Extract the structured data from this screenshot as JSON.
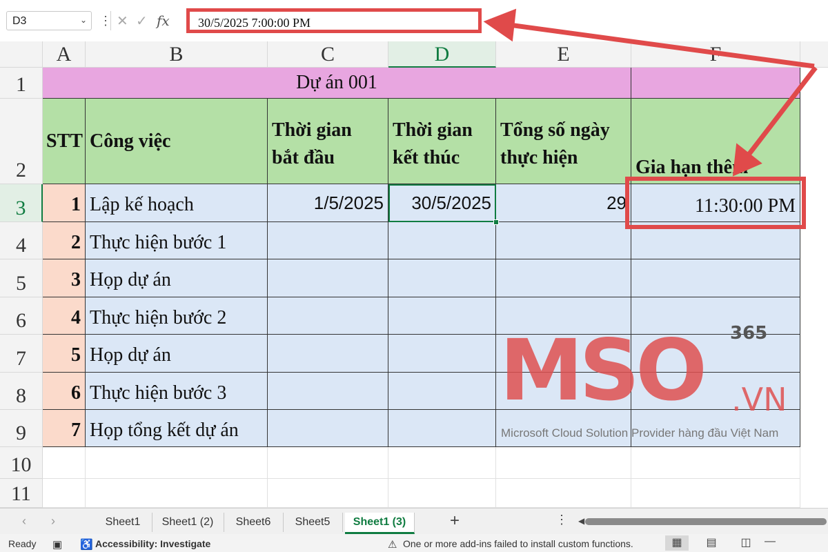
{
  "formula_bar": {
    "name_box": "D3",
    "cancel_icon": "✕",
    "enter_icon": "✓",
    "fx_label": "fx",
    "formula_value": "30/5/2025  7:00:00 PM"
  },
  "columns": [
    "A",
    "B",
    "C",
    "D",
    "E",
    "F"
  ],
  "rows": [
    "1",
    "2",
    "3",
    "4",
    "5",
    "6",
    "7",
    "8",
    "9",
    "10",
    "11"
  ],
  "sheet": {
    "title": "Dự án 001",
    "headers": {
      "stt": "STT",
      "cong_viec": "Công việc",
      "thoi_gian_bat_dau_1": "Thời gian",
      "thoi_gian_bat_dau_2": "bắt đầu",
      "thoi_gian_ket_thuc_1": "Thời gian",
      "thoi_gian_ket_thuc_2": "kết thúc",
      "tong_so_ngay_1": "Tổng số ngày",
      "tong_so_ngay_2": "thực hiện",
      "gia_han_them": "Gia hạn thêm"
    },
    "tasks": [
      {
        "stt": "1",
        "name": "Lập kế hoạch",
        "start": "1/5/2025",
        "end": "30/5/2025",
        "days": "29",
        "extend": "11:30:00 PM"
      },
      {
        "stt": "2",
        "name": "Thực hiện bước 1"
      },
      {
        "stt": "3",
        "name": "Họp dự án"
      },
      {
        "stt": "4",
        "name": "Thực hiện bước 2"
      },
      {
        "stt": "5",
        "name": "Họp dự án"
      },
      {
        "stt": "6",
        "name": "Thực hiện bước 3"
      },
      {
        "stt": "7",
        "name": "Họp tổng kết dự án"
      }
    ]
  },
  "watermark": {
    "logo": "MSO",
    "sup": "365",
    "domain": ".VN",
    "tagline": "Microsoft Cloud Solution Provider hàng đầu Việt Nam"
  },
  "sheet_tabs": [
    "Sheet1",
    "Sheet1 (2)",
    "Sheet6",
    "Sheet5",
    "Sheet1 (3)"
  ],
  "active_tab": "Sheet1 (3)",
  "status": {
    "ready": "Ready",
    "accessibility": "Accessibility: Investigate",
    "addins": "One or more add-ins failed to install custom functions."
  },
  "colors": {
    "title_bg": "#e8a6e0",
    "header_bg": "#b4e0a6",
    "data_bg": "#dbe7f6",
    "stt_bg": "#fbdacb",
    "highlight": "#e04a4a",
    "excel_green": "#107c41"
  }
}
